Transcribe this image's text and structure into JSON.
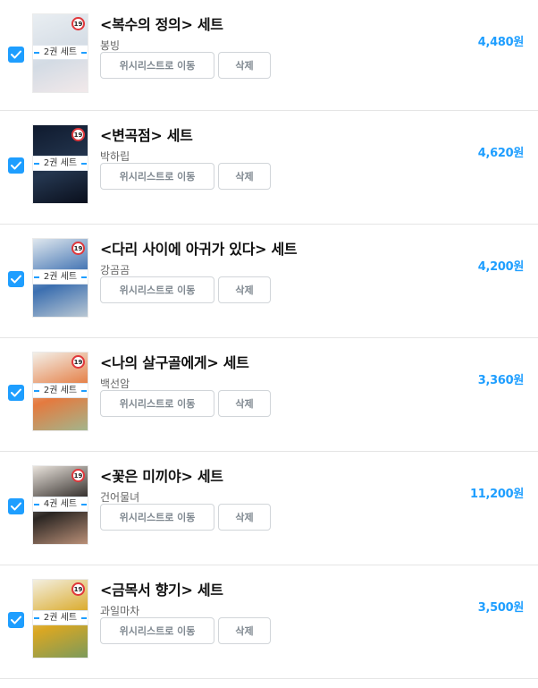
{
  "items": [
    {
      "title": "<복수의 정의> 세트",
      "author": "봉빙",
      "price": "4,480원",
      "set_label": "2권 세트",
      "age": "19",
      "cover_colors": [
        "#e9eef2",
        "#d3dbe4",
        "#f2e9ea"
      ]
    },
    {
      "title": "<변곡점> 세트",
      "author": "박하립",
      "price": "4,620원",
      "set_label": "2권 세트",
      "age": "19",
      "cover_colors": [
        "#0f1a2e",
        "#24364f",
        "#0a0f1c"
      ]
    },
    {
      "title": "<다리 사이에 아귀가 있다> 세트",
      "author": "강곰곰",
      "price": "4,200원",
      "set_label": "2권 세트",
      "age": "19",
      "cover_colors": [
        "#dfe7ee",
        "#3c6fb0",
        "#b9c7d3"
      ]
    },
    {
      "title": "<나의 살구골에게> 세트",
      "author": "백선암",
      "price": "3,360원",
      "set_label": "2권 세트",
      "age": "19",
      "cover_colors": [
        "#f3efe8",
        "#e47a3f",
        "#a3b58c"
      ]
    },
    {
      "title": "<꽃은 미끼야> 세트",
      "author": "건어물녀",
      "price": "11,200원",
      "set_label": "4권 세트",
      "age": "19",
      "cover_colors": [
        "#e9e3dc",
        "#2b2623",
        "#b98f77"
      ]
    },
    {
      "title": "<금목서 향기> 세트",
      "author": "과일마차",
      "price": "3,500원",
      "set_label": "2권 세트",
      "age": "19",
      "cover_colors": [
        "#f3efe0",
        "#d9a723",
        "#7c9a5b"
      ]
    }
  ],
  "buttons": {
    "wishlist": "위시리스트로 이동",
    "delete": "삭제"
  },
  "accent_color": "#1e9eff",
  "age_badge_color": "#e0373b"
}
